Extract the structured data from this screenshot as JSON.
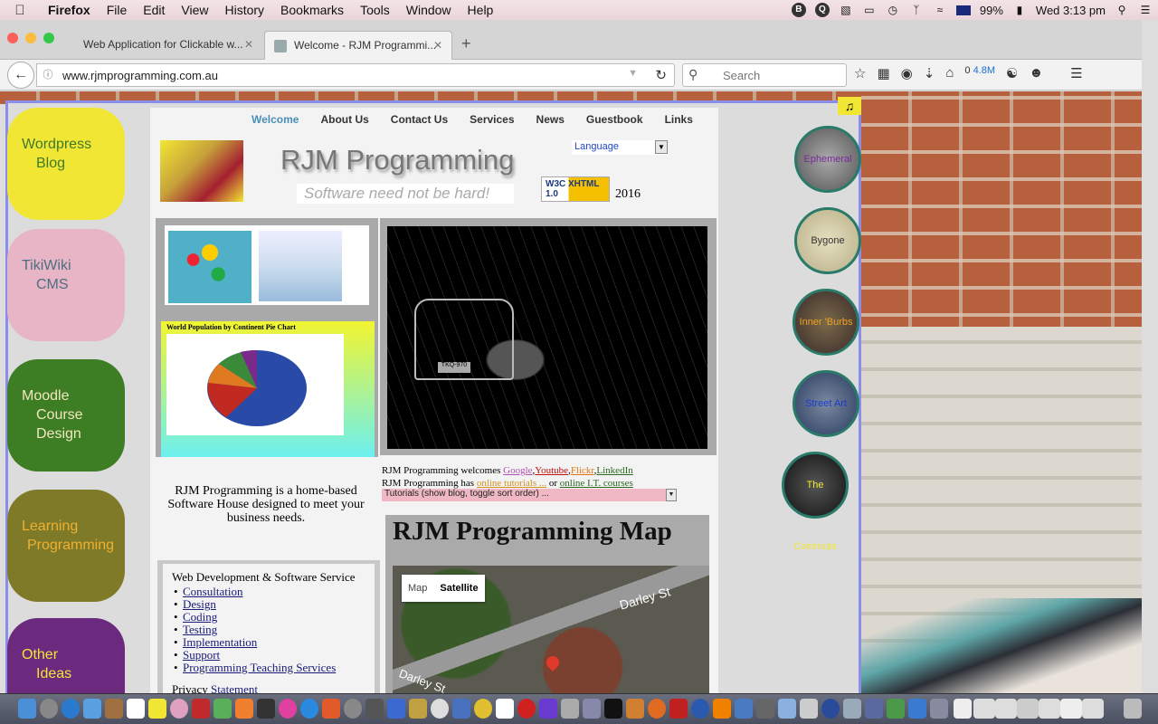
{
  "menubar": {
    "app": "Firefox",
    "items": [
      "File",
      "Edit",
      "View",
      "History",
      "Bookmarks",
      "Tools",
      "Window",
      "Help"
    ],
    "battery": "99%",
    "clock": "Wed 3:13 pm"
  },
  "tabs": [
    {
      "title": "Web Application for Clickable w..."
    },
    {
      "title": "Welcome - RJM Programmi..."
    }
  ],
  "navbar": {
    "url": "www.rjmprogramming.com.au",
    "search_placeholder": "Search",
    "download_count": "0",
    "download_size": "4.8M"
  },
  "sidebar": {
    "items": [
      {
        "line1": "Wordpress",
        "line2": "Blog"
      },
      {
        "line1": "TikiWiki",
        "line2": "CMS"
      },
      {
        "line1": "Moodle",
        "line2": "Course",
        "line3": "Design"
      },
      {
        "line1": "Learning",
        "line2": "Programming"
      },
      {
        "line1": "Other",
        "line2": "Ideas"
      }
    ]
  },
  "topnav": [
    "Welcome",
    "About Us",
    "Contact Us",
    "Services",
    "News",
    "Guestbook",
    "Links"
  ],
  "header": {
    "brand": "RJM Programming",
    "tagline": "Software need not be hard!",
    "language": "Language",
    "badge": "XHTML 1.0",
    "year": "2016"
  },
  "pie": {
    "title": "World Population by Continent Pie Chart"
  },
  "photo": {
    "plate": "TKQ-970"
  },
  "about": "RJM Programming is a home-based Software House designed to meet your business needs.",
  "welcome_line": {
    "prefix": "RJM Programming welcomes",
    "links": [
      "Google",
      "Youtube",
      "Flickr",
      "LinkedIn"
    ]
  },
  "has_line": {
    "prefix": "RJM Programming has",
    "tutorials": "online tutorials ...",
    "or": "or",
    "courses": "online I.T. courses"
  },
  "tutorials_select": "Tutorials (show blog, toggle sort order) ...",
  "services": {
    "heading": "Web Development & Software Service",
    "items": [
      "Consultation",
      "Design",
      "Coding",
      "Testing",
      "Implementation",
      "Support",
      "Programming Teaching Services"
    ],
    "privacy_prefix": "Privacy",
    "privacy_link": "Statement"
  },
  "map": {
    "title": "RJM Programming Map",
    "toggle_map": "Map",
    "toggle_satellite": "Satellite",
    "street_top": "Darley St",
    "street_bottom": "Darley St"
  },
  "circles": [
    "Ephemeral",
    "Bygone",
    "Inner 'Burbs",
    "Street Art",
    "The Commute"
  ],
  "music_icon": "♫"
}
